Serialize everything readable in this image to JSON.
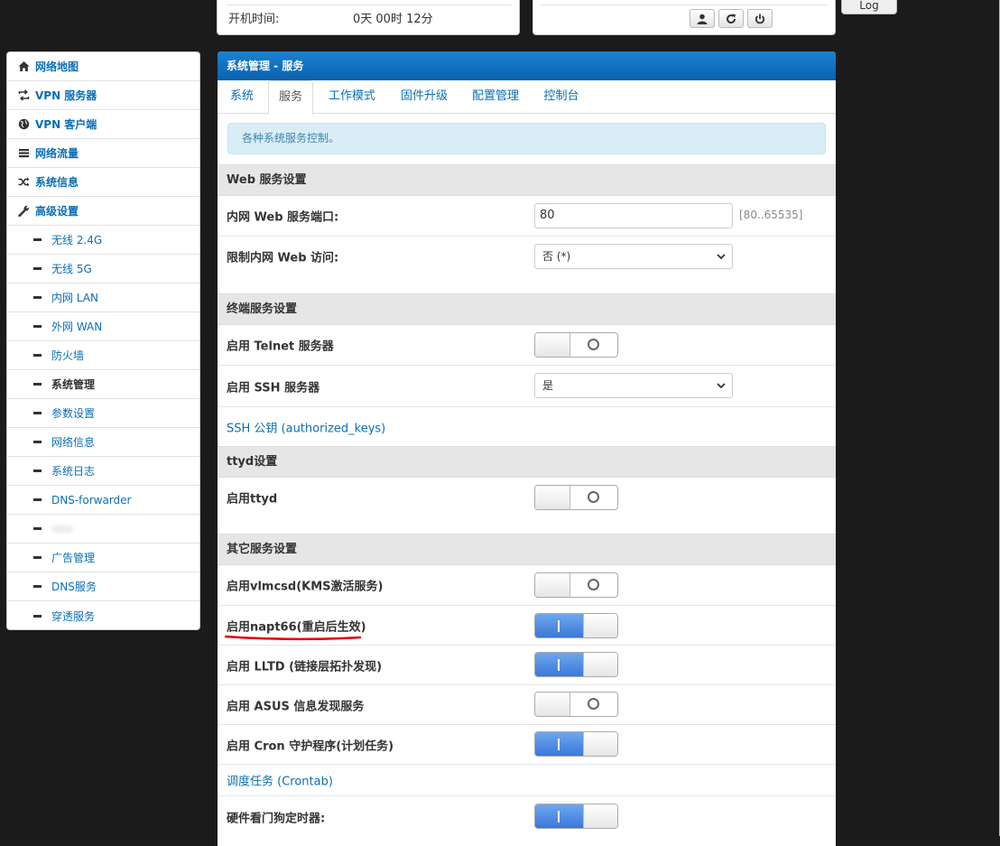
{
  "top": {
    "uptime_label": "开机时间:",
    "uptime_value": "0天 00时 12分",
    "log_button": "Log",
    "controls": [
      "user-icon",
      "refresh-icon",
      "power-icon"
    ]
  },
  "sidebar": {
    "main_items": [
      {
        "label": "网络地图",
        "icon": "home-icon"
      },
      {
        "label": "VPN 服务器",
        "icon": "retweet-icon"
      },
      {
        "label": "VPN 客户端",
        "icon": "globe-icon"
      },
      {
        "label": "网络流量",
        "icon": "list-icon"
      },
      {
        "label": "系统信息",
        "icon": "shuffle-icon"
      },
      {
        "label": "高级设置",
        "icon": "wrench-icon"
      }
    ],
    "sub_items": [
      {
        "label": "无线 2.4G"
      },
      {
        "label": "无线 5G"
      },
      {
        "label": "内网 LAN"
      },
      {
        "label": "外网 WAN"
      },
      {
        "label": "防火墙"
      },
      {
        "label": "系统管理",
        "active": true
      },
      {
        "label": "参数设置"
      },
      {
        "label": "网络信息"
      },
      {
        "label": "系统日志"
      },
      {
        "label": "DNS-forwarder"
      },
      {
        "label": ""
      },
      {
        "label": "广告管理"
      },
      {
        "label": "DNS服务"
      },
      {
        "label": "穿透服务"
      }
    ]
  },
  "panel": {
    "title": "系统管理 - 服务",
    "tabs": [
      "系统",
      "服务",
      "工作模式",
      "固件升级",
      "配置管理",
      "控制台"
    ],
    "active_tab": "服务",
    "alert": "各种系统服务控制。"
  },
  "web": {
    "heading": "Web 服务设置",
    "port_label": "内网 Web 服务端口:",
    "port_value": "80",
    "port_hint": "[80..65535]",
    "limit_label": "限制内网 Web 访问:",
    "limit_value": "否 (*)"
  },
  "terminal": {
    "heading": "终端服务设置",
    "telnet_label": "启用 Telnet 服务器",
    "telnet_on": false,
    "ssh_label": "启用 SSH 服务器",
    "ssh_value": "是",
    "ssh_keys_link": "SSH 公钥 (authorized_keys)"
  },
  "ttyd": {
    "heading": "ttyd设置",
    "enable_label": "启用ttyd",
    "enable_on": false
  },
  "other": {
    "heading": "其它服务设置",
    "vlmcsd_label": "启用vlmcsd(KMS激活服务)",
    "vlmcsd_on": false,
    "napt66_label": "启用napt66(重启后生效)",
    "napt66_on": true,
    "lltd_label": "启用 LLTD (链接层拓扑发现)",
    "lltd_on": true,
    "asus_label": "启用 ASUS 信息发现服务",
    "asus_on": false,
    "cron_label": "启用 Cron 守护程序(计划任务)",
    "cron_on": true,
    "crontab_link": "调度任务 (Crontab)",
    "watchdog_label": "硬件看门狗定时器:",
    "watchdog_on": true
  },
  "colors": {
    "accent": "#0a6fb4",
    "header_blue": "#1677c9",
    "toggle_on": "#4a86e0",
    "annotation_red": "#e00000"
  }
}
